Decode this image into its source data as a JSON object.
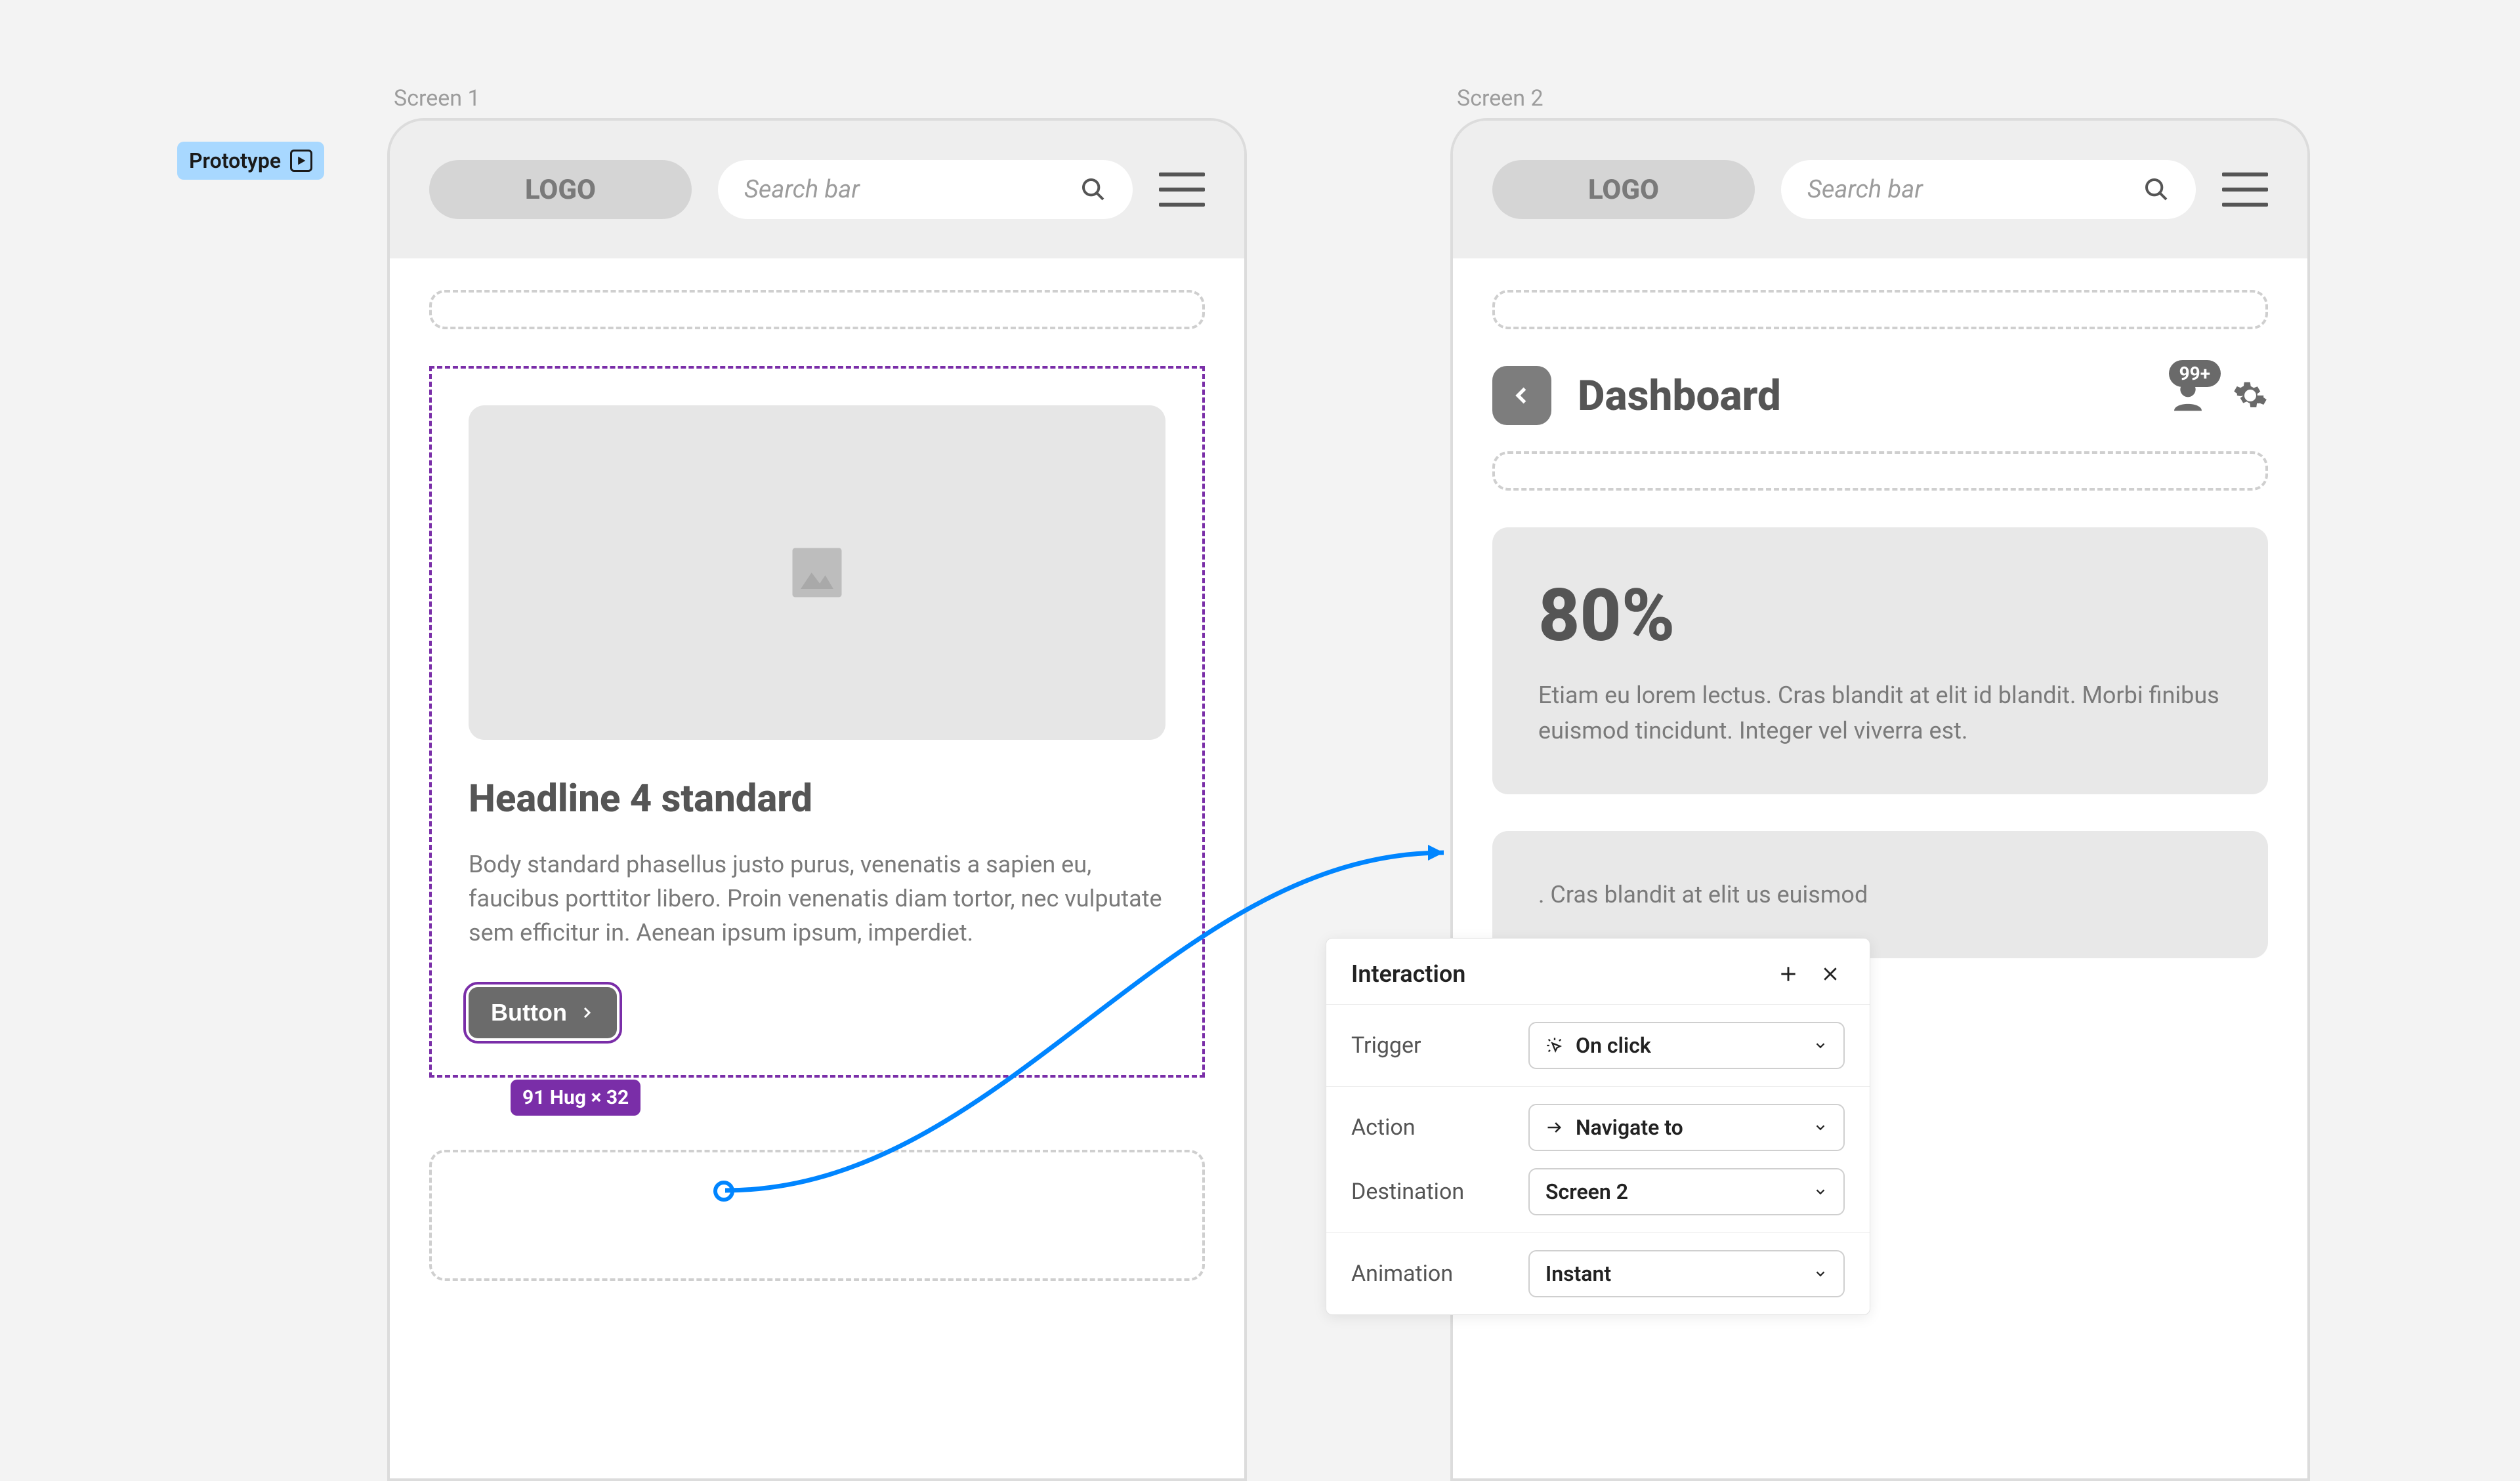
{
  "tag": {
    "label": "Prototype"
  },
  "frames": {
    "left_label": "Screen 1",
    "right_label": "Screen 2"
  },
  "header": {
    "logo": "LOGO",
    "search_placeholder": "Search bar"
  },
  "card": {
    "headline": "Headline 4 standard",
    "body": "Body standard phasellus justo purus, venenatis a sapien eu, faucibus porttitor libero. Proin venenatis diam tortor, nec vulputate sem efficitur in. Aenean ipsum ipsum, imperdiet.",
    "button_label": "Button",
    "size_badge": "91 Hug × 32"
  },
  "dashboard": {
    "title": "Dashboard",
    "badge": "99+",
    "stat_value": "80%",
    "stat_body": "Etiam eu lorem lectus. Cras blandit at elit id blandit. Morbi finibus euismod tincidunt. Integer vel viverra est.",
    "stat_body2": ". Cras blandit at elit us euismod"
  },
  "interaction_panel": {
    "title": "Interaction",
    "rows": {
      "trigger": {
        "label": "Trigger",
        "value": "On click"
      },
      "action": {
        "label": "Action",
        "value": "Navigate to"
      },
      "destination": {
        "label": "Destination",
        "value": "Screen 2"
      },
      "animation": {
        "label": "Animation",
        "value": "Instant"
      }
    }
  }
}
